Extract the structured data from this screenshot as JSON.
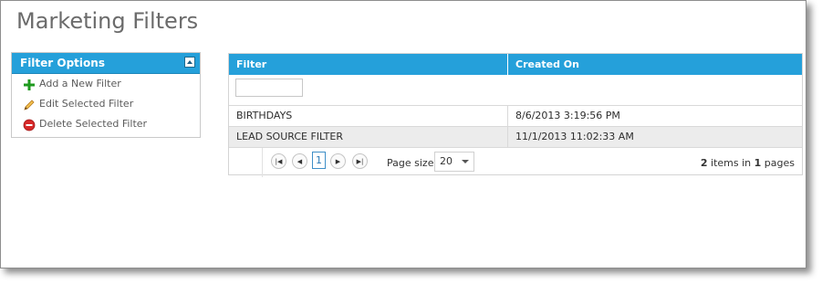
{
  "page": {
    "title": "Marketing Filters"
  },
  "sidebar": {
    "header": "Filter Options",
    "collapse_icon": "collapse-up-icon",
    "items": [
      {
        "label": "Add a New Filter",
        "icon": "plus-icon",
        "color": "#1e9a1e"
      },
      {
        "label": "Edit Selected Filter",
        "icon": "pencil-icon",
        "color": "#e3a21a"
      },
      {
        "label": "Delete Selected Filter",
        "icon": "delete-icon",
        "color": "#d62828"
      }
    ]
  },
  "grid": {
    "columns": [
      "Filter",
      "Created On"
    ],
    "filter_input": {
      "value": "",
      "placeholder": ""
    },
    "rows": [
      {
        "filter": "BIRTHDAYS",
        "created_on": "8/6/2013 3:19:56 PM"
      },
      {
        "filter": "LEAD SOURCE FILTER",
        "created_on": "11/1/2013 11:02:33 AM"
      }
    ],
    "pager": {
      "first_icon": "first-page-icon",
      "prev_icon": "prev-page-icon",
      "current_page": "1",
      "next_icon": "next-page-icon",
      "last_icon": "last-page-icon",
      "page_size_label": "Page size:",
      "page_size_value": "20",
      "items_count": "2",
      "items_text_mid": "items in",
      "pages_count": "1",
      "items_text_end": "pages"
    }
  },
  "colors": {
    "accent": "#25a0da",
    "alt_row": "#ececec"
  }
}
